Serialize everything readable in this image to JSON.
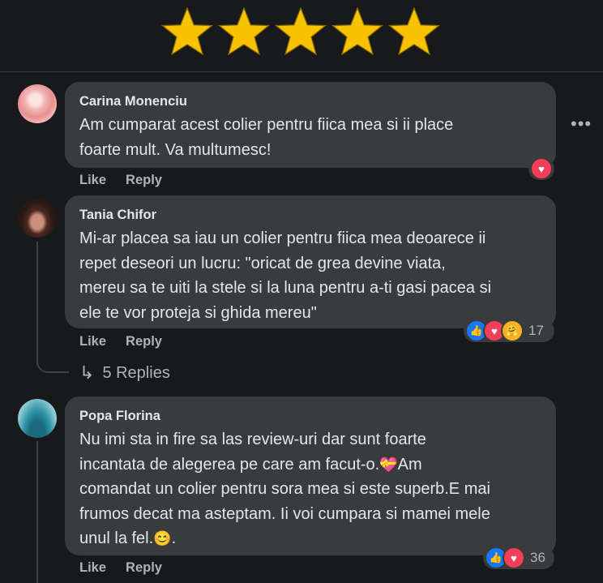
{
  "rating": {
    "value": 5,
    "max": 5,
    "color": "#f7c200",
    "stroke": "#8a6a00"
  },
  "comments": [
    {
      "author": "Carina Monenciu",
      "text": "Am cumparat acest colier pentru fiica mea si ii place\nfoarte mult. Va multumesc!",
      "like_label": "Like",
      "reply_label": "Reply",
      "reactions": [
        "love"
      ],
      "reaction_count": ""
    },
    {
      "author": "Tania Chifor",
      "text": "Mi-ar placea sa iau un colier pentru fiica mea deoarece ii\nrepet deseori un lucru: \"oricat de grea devine viata,\nmereu sa te uiti la stele si la luna pentru a-ti gasi pacea si\nele te vor proteja si ghida mereu\"",
      "like_label": "Like",
      "reply_label": "Reply",
      "reactions": [
        "like",
        "love",
        "care"
      ],
      "reaction_count": "17",
      "replies_label": "5 Replies"
    },
    {
      "author": "Popa Florina",
      "text_lines": [
        "Nu imi sta in fire sa las review-uri dar sunt foarte",
        "incantata de alegerea pe care am facut-o.",
        "Am",
        "comandat un colier pentru sora mea si este superb.E mai",
        "frumos decat ma asteptam. Ii voi cumpara si mamei mele",
        "unul la fel.",
        "."
      ],
      "emoji_gift": "💝",
      "emoji_smile": "😊",
      "like_label": "Like",
      "reply_label": "Reply",
      "reactions": [
        "like",
        "love"
      ],
      "reaction_count": "36"
    }
  ],
  "more_label": "•••",
  "replies_arrow": "↳",
  "icons": {
    "like": "👍",
    "love": "♥",
    "care": "🤗"
  }
}
